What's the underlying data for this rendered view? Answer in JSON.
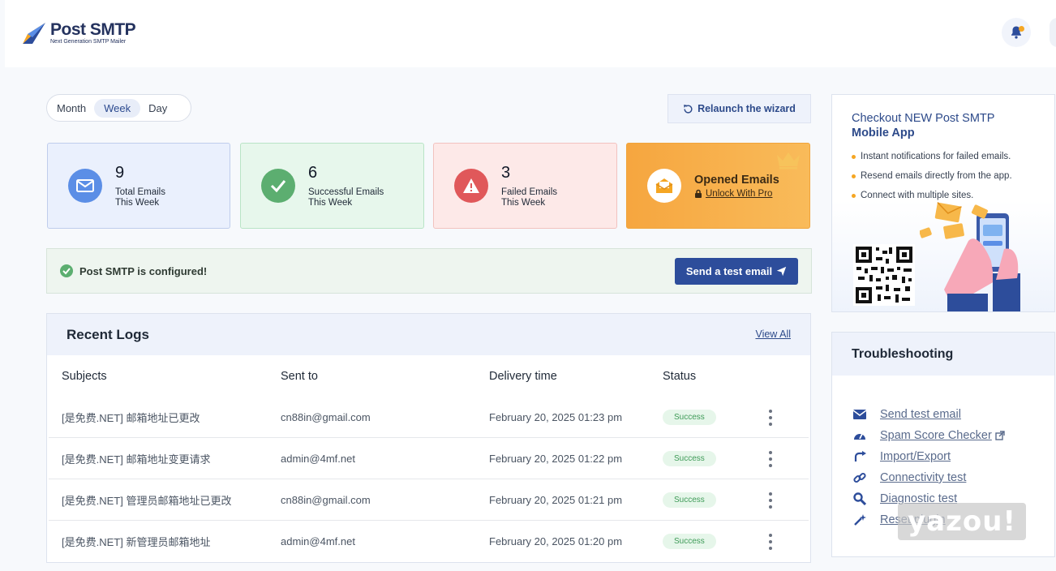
{
  "header": {
    "logo_title": "Post SMTP",
    "logo_subtitle": "Next Generation SMTP Mailer",
    "notification_dot_color": "#f5a623"
  },
  "period": {
    "options": [
      "Month",
      "Week",
      "Day"
    ],
    "selected": "Week"
  },
  "toolbar": {
    "relaunch_label": "Relaunch the wizard"
  },
  "stats": {
    "total": {
      "value": "9",
      "label": "Total Emails",
      "period": "This Week"
    },
    "success": {
      "value": "6",
      "label": "Successful Emails",
      "period": "This Week"
    },
    "failed": {
      "value": "3",
      "label": "Failed Emails",
      "period": "This Week"
    },
    "opened": {
      "label": "Opened Emails",
      "unlock": "Unlock With Pro"
    }
  },
  "status": {
    "message": "Post SMTP is configured!",
    "send_test_label": "Send a test email"
  },
  "logs": {
    "title": "Recent Logs",
    "view_all": "View All",
    "columns": [
      "Subjects",
      "Sent to",
      "Delivery time",
      "Status"
    ],
    "rows": [
      {
        "subject": "[是免费.NET] 邮箱地址已更改",
        "to": "cn88in@gmail.com",
        "time": "February 20, 2025 01:23 pm",
        "status": "Success"
      },
      {
        "subject": "[是免费.NET] 邮箱地址变更请求",
        "to": "admin@4mf.net",
        "time": "February 20, 2025 01:22 pm",
        "status": "Success"
      },
      {
        "subject": "[是免费.NET] 管理员邮箱地址已更改",
        "to": "cn88in@gmail.com",
        "time": "February 20, 2025 01:21 pm",
        "status": "Success"
      },
      {
        "subject": "[是免费.NET] 新管理员邮箱地址",
        "to": "admin@4mf.net",
        "time": "February 20, 2025 01:20 pm",
        "status": "Success"
      }
    ]
  },
  "promo": {
    "line1": "Checkout NEW Post SMTP",
    "line2": "Mobile App",
    "features": [
      "Instant notifications for failed emails.",
      "Resend emails directly from the app.",
      "Connect with multiple sites."
    ]
  },
  "troubleshooting": {
    "title": "Troubleshooting",
    "items": [
      {
        "label": "Send test email",
        "icon": "envelope-icon"
      },
      {
        "label": "Spam Score Checker",
        "icon": "gauge-icon"
      },
      {
        "label": "Import/Export",
        "icon": "redo-arrow-icon"
      },
      {
        "label": "Connectivity test",
        "icon": "link-icon"
      },
      {
        "label": "Diagnostic test",
        "icon": "magnifier-icon"
      },
      {
        "label": "Reset plugin",
        "icon": "magic-wand-icon"
      }
    ]
  },
  "watermark": "yazou!",
  "colors": {
    "primary": "#2d4d9b",
    "success": "#5cae70",
    "danger": "#e0585a",
    "accent": "#f5a623"
  }
}
